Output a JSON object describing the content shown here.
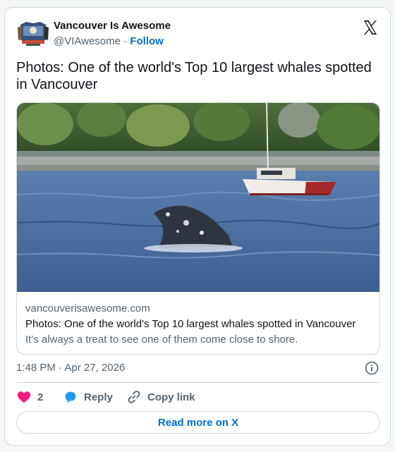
{
  "author": {
    "name": "Vancouver Is Awesome",
    "handle": "@VIAwesome",
    "separator": "·",
    "follow_label": "Follow",
    "avatar_icon": "vancouver-crest-logo"
  },
  "platform_icon": "x-logo-icon",
  "tweet": {
    "text": "Photos: One of the world's Top 10 largest whales spotted in Vancouver"
  },
  "link_card": {
    "image_icon": "whale-photo",
    "domain": "vancouverisawesome.com",
    "title": "Photos: One of the world's Top 10 largest whales spotted in Vancouver",
    "description": "It's always a treat to see one of them come close to shore."
  },
  "meta": {
    "timestamp": "1:48 PM · Apr 27, 2026",
    "info_icon": "info-icon"
  },
  "actions": {
    "like_count": "2",
    "reply_label": "Reply",
    "copy_label": "Copy link"
  },
  "read_more_label": "Read more on X",
  "colors": {
    "like": "#f91880",
    "reply": "#1d9bf0",
    "link": "#006fd6",
    "muted": "#536471"
  }
}
